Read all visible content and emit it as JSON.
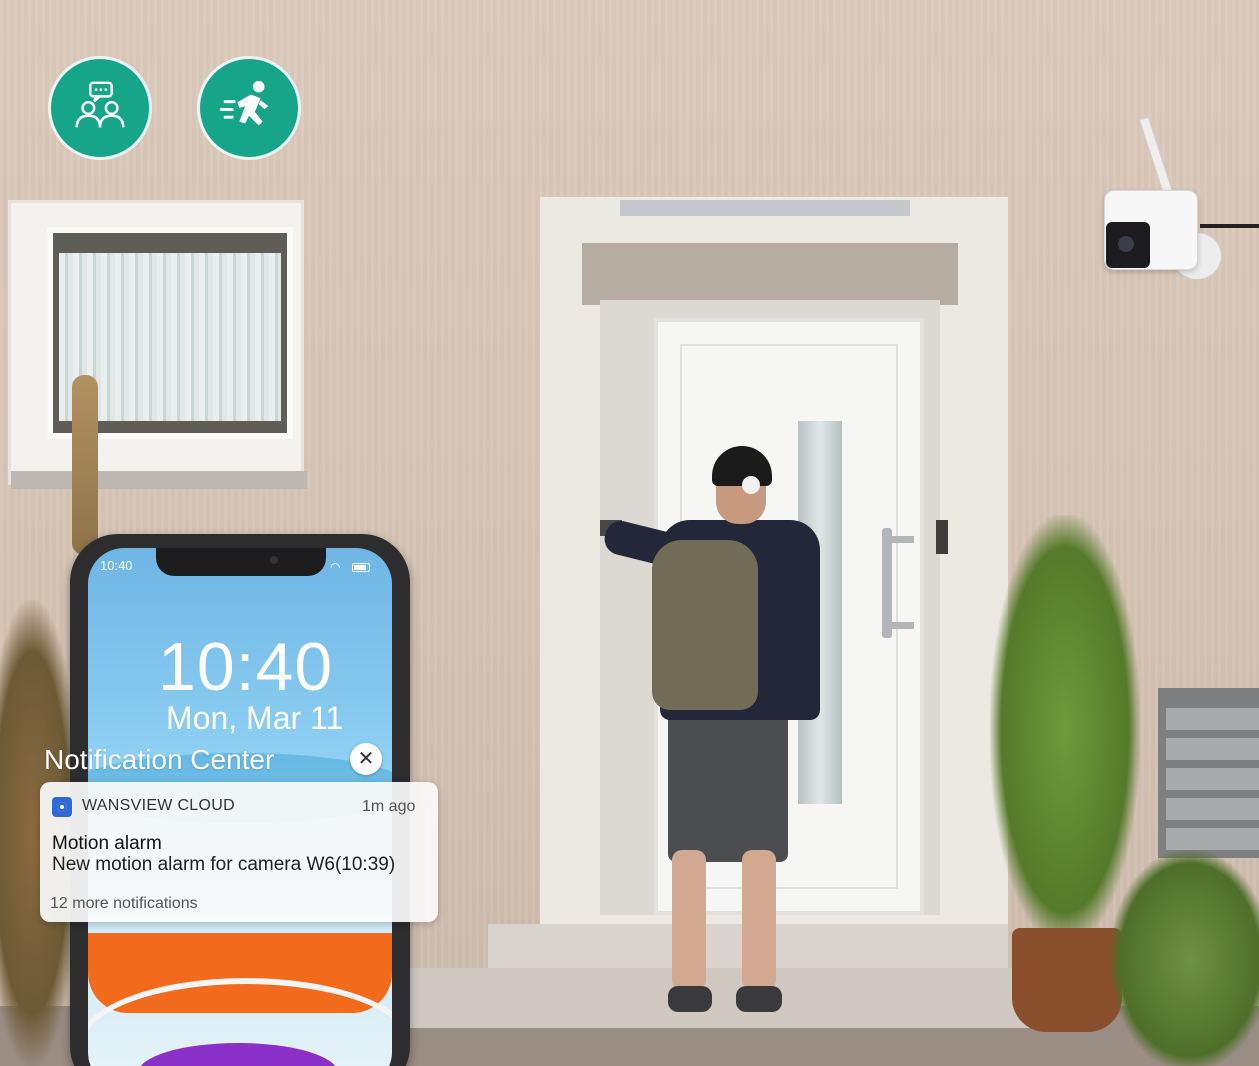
{
  "feature_badges": [
    {
      "icon": "two-way-talk-icon"
    },
    {
      "icon": "motion-detection-icon"
    }
  ],
  "phone": {
    "status_time": "10:40",
    "lock_time": "10:40",
    "lock_date": "Mon, Mar 11",
    "notification_center_title": "Notification Center",
    "notification": {
      "app_name": "WANSVIEW CLOUD",
      "time_ago": "1m ago",
      "title": "Motion alarm",
      "body": "New motion alarm for camera W6(10:39)",
      "more": "12 more notifications"
    }
  },
  "colors": {
    "badge": "#17a58a",
    "wall": "#dccbbd"
  }
}
